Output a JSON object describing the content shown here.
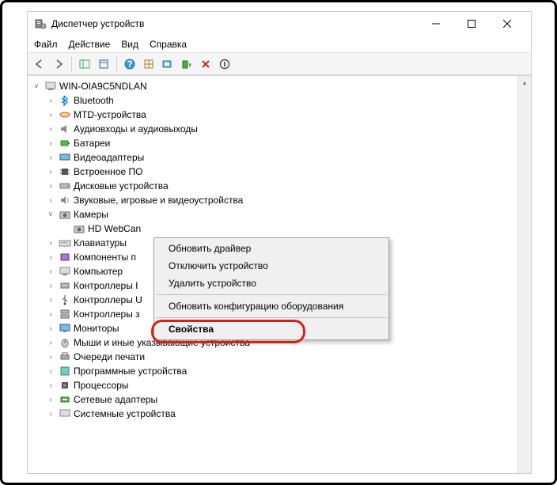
{
  "window": {
    "title": "Диспетчер устройств"
  },
  "menu": {
    "file": "Файл",
    "action": "Действие",
    "view": "Вид",
    "help": "Справка"
  },
  "root": "WIN-OIA9C5NDLAN",
  "categories": {
    "bluetooth": "Bluetooth",
    "mtd": "MTD-устройства",
    "audio": "Аудиовходы и аудиовыходы",
    "battery": "Батареи",
    "video": "Видеоадаптеры",
    "firmware": "Встроенное ПО",
    "disk": "Дисковые устройства",
    "sound_game": "Звуковые, игровые и видеоустройства",
    "cameras": "Камеры",
    "hd_webcan": "HD WebCan",
    "keyboard": "Клавиатуры",
    "print_comp": "Компоненты п",
    "computer": "Компьютер",
    "ide": "Контроллеры I",
    "usb": "Контроллеры U",
    "storage_ctrl": "Контроллеры з",
    "monitor": "Мониторы",
    "mouse": "Мыши и иные указывающие устройства",
    "print_queue": "Очереди печати",
    "software_dev": "Программные устройства",
    "cpu": "Процессоры",
    "net": "Сетевые адаптеры",
    "system": "Системные устройства"
  },
  "ctx": {
    "update": "Обновить драйвер",
    "disable": "Отключить устройство",
    "remove": "Удалить устройство",
    "scan": "Обновить конфигурацию оборудования",
    "props": "Свойства"
  }
}
